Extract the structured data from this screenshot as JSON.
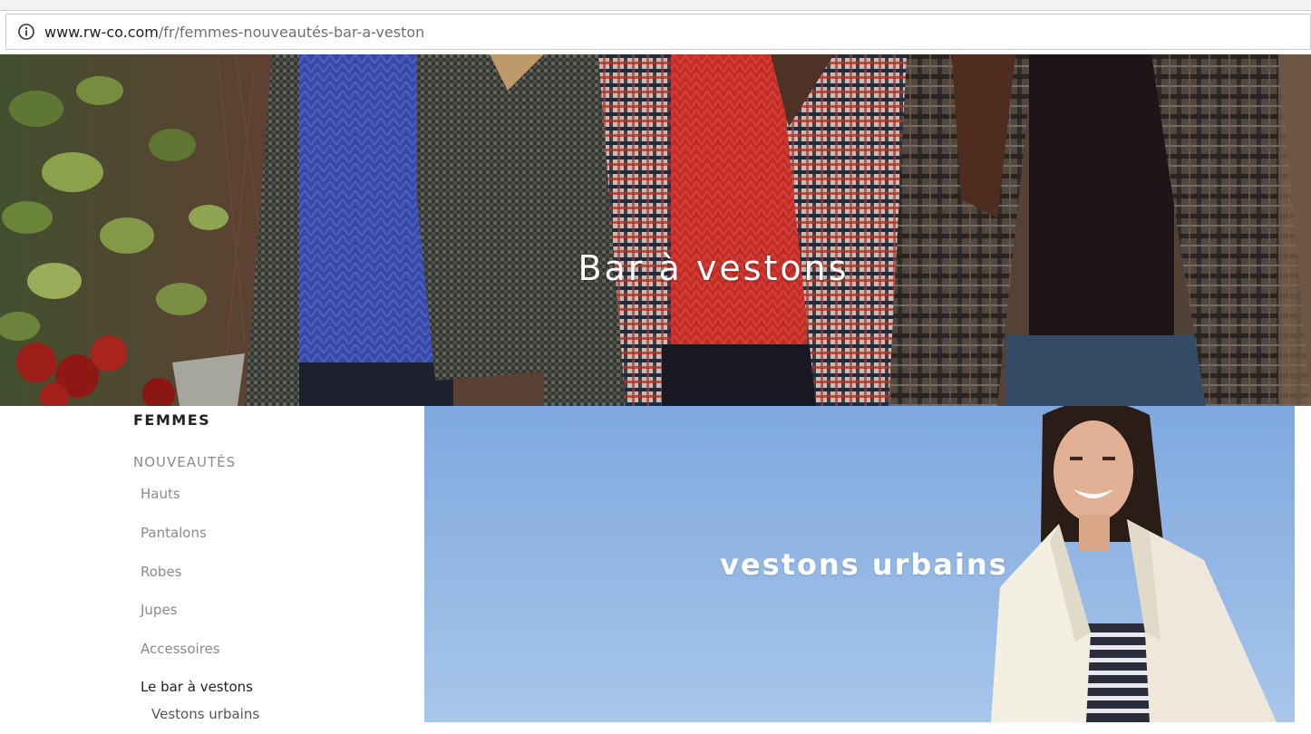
{
  "browser": {
    "url_host": "www.rw-co.com",
    "url_path": "/fr/femmes-nouveautés-bar-a-veston"
  },
  "hero": {
    "title": "Bar à vestons"
  },
  "nav": {
    "heading": "FEMMES",
    "section": "NOUVEAUTÉS",
    "items": [
      {
        "label": "Hauts"
      },
      {
        "label": "Pantalons"
      },
      {
        "label": "Robes"
      },
      {
        "label": "Jupes"
      },
      {
        "label": "Accessoires"
      },
      {
        "label": "Le bar à vestons"
      }
    ],
    "sub_item": "Vestons urbains"
  },
  "promo": {
    "title": "vestons urbains"
  }
}
